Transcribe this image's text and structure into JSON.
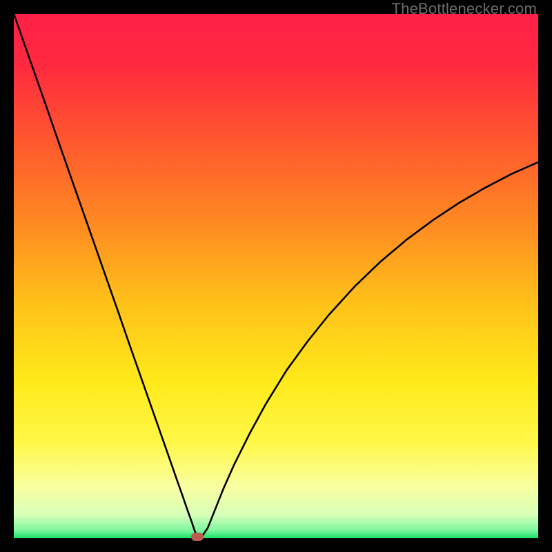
{
  "watermark": {
    "text": "TheBottlenecker.com"
  },
  "chart_data": {
    "type": "line",
    "title": "",
    "xlabel": "",
    "ylabel": "",
    "xlim": [
      0,
      100
    ],
    "ylim": [
      0,
      100
    ],
    "gradient_stops": [
      {
        "offset": 0.0,
        "color": "#ff1f47"
      },
      {
        "offset": 0.1,
        "color": "#ff2a3f"
      },
      {
        "offset": 0.25,
        "color": "#ff5a2e"
      },
      {
        "offset": 0.4,
        "color": "#ff8a22"
      },
      {
        "offset": 0.55,
        "color": "#ffc11a"
      },
      {
        "offset": 0.7,
        "color": "#ffe91a"
      },
      {
        "offset": 0.82,
        "color": "#fff84a"
      },
      {
        "offset": 0.9,
        "color": "#faffa0"
      },
      {
        "offset": 0.955,
        "color": "#d8ffb8"
      },
      {
        "offset": 0.985,
        "color": "#7ef7a0"
      },
      {
        "offset": 1.0,
        "color": "#18e06a"
      }
    ],
    "series": [
      {
        "name": "bottleneck-curve",
        "color": "#000000",
        "stroke_width": 2.6,
        "x": [
          0.0,
          2.0,
          4.0,
          6.0,
          8.0,
          10.0,
          12.0,
          14.0,
          16.0,
          18.0,
          20.0,
          22.0,
          24.0,
          26.0,
          28.0,
          30.0,
          31.0,
          32.0,
          33.0,
          34.0,
          34.5,
          35.0,
          35.5,
          36.0,
          37.0,
          38.0,
          40.0,
          42.0,
          45.0,
          48.0,
          52.0,
          56.0,
          60.0,
          65.0,
          70.0,
          75.0,
          80.0,
          85.0,
          90.0,
          95.0,
          100.0
        ],
        "y": [
          100.0,
          94.3,
          88.6,
          82.9,
          77.1,
          71.4,
          65.7,
          60.0,
          54.3,
          48.6,
          42.9,
          37.1,
          31.4,
          25.7,
          20.0,
          14.3,
          11.4,
          8.6,
          5.7,
          2.9,
          1.4,
          0.2,
          0.2,
          0.5,
          2.0,
          4.5,
          9.5,
          14.0,
          20.0,
          25.5,
          32.0,
          37.5,
          42.5,
          48.0,
          52.8,
          57.0,
          60.7,
          64.0,
          66.9,
          69.5,
          71.7
        ]
      }
    ],
    "marker": {
      "x": 35.0,
      "y": 0.0,
      "color": "#bb5d50"
    }
  }
}
